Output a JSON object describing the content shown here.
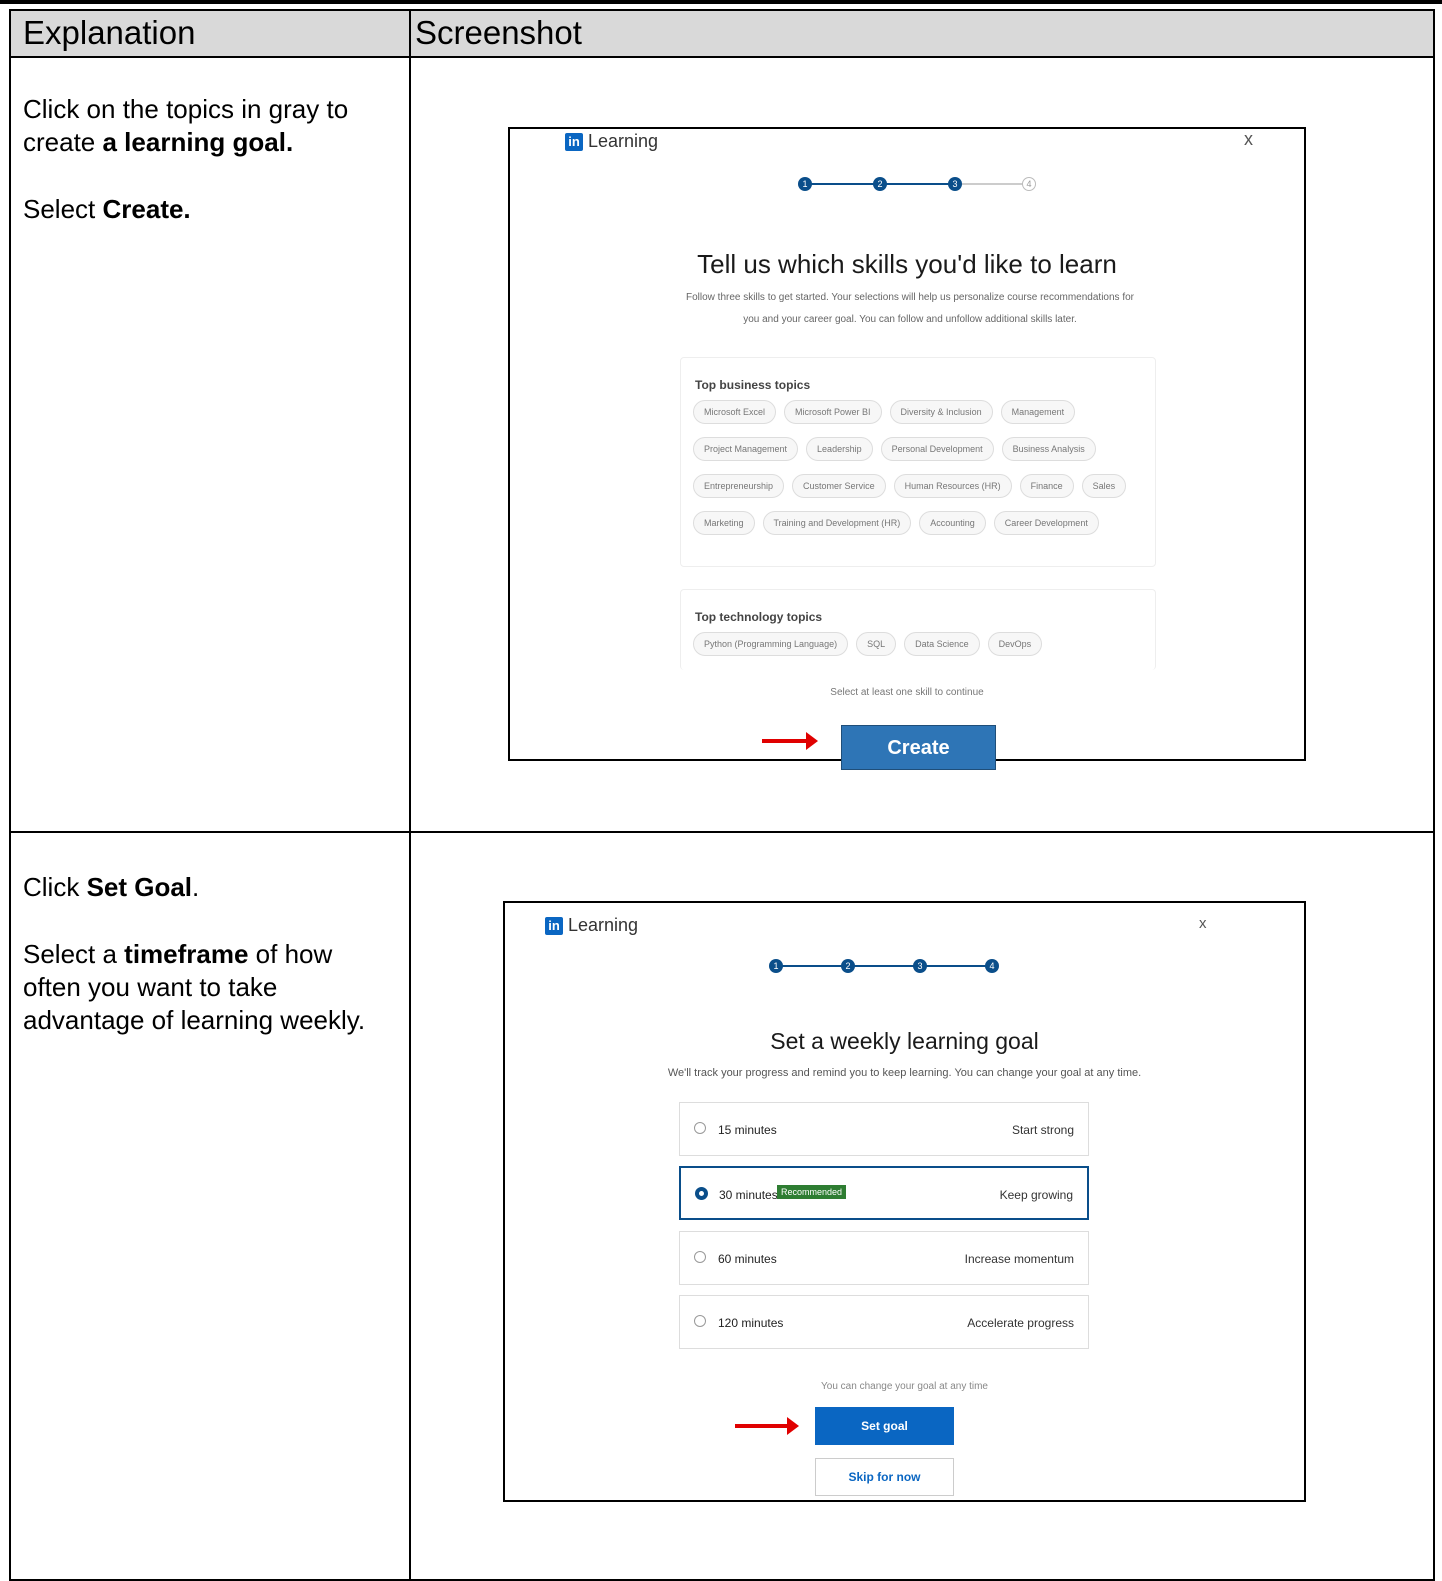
{
  "table": {
    "header_left": "Explanation",
    "header_right": "Screenshot"
  },
  "row1": {
    "explanation": {
      "line1_text": "Click on the topics in gray to create ",
      "line1_bold": "a learning goal.",
      "line2_text": "Select ",
      "line2_bold": "Create."
    },
    "screenshot": {
      "brand_icon": "in",
      "brand_label": "Learning",
      "close_label": "x",
      "steps": [
        "1",
        "2",
        "3",
        "4"
      ],
      "title": "Tell us which skills you'd like to learn",
      "subtitle": "Follow three skills to get started. Your selections will help us personalize course recommendations for you and your career goal. You can follow and unfollow additional skills later.",
      "business_heading": "Top business topics",
      "business_topics": [
        "Microsoft Excel",
        "Microsoft Power BI",
        "Diversity & Inclusion",
        "Management",
        "Project Management",
        "Leadership",
        "Personal Development",
        "Business Analysis",
        "Entrepreneurship",
        "Customer Service",
        "Human Resources (HR)",
        "Finance",
        "Sales",
        "Marketing",
        "Training and Development (HR)",
        "Accounting",
        "Career Development"
      ],
      "technology_heading": "Top technology topics",
      "technology_topics": [
        "Python (Programming Language)",
        "SQL",
        "Data Science",
        "DevOps"
      ],
      "hint": "Select at least one skill to continue",
      "create_button": "Create"
    }
  },
  "row2": {
    "explanation": {
      "line1_text": "Click ",
      "line1_bold": "Set Goal",
      "line1_end": ".",
      "line2_text": "Select a ",
      "line2_bold": "timeframe",
      "line2_end": " of how often you want to take advantage of learning weekly."
    },
    "screenshot": {
      "brand_icon": "in",
      "brand_label": "Learning",
      "close_label": "x",
      "steps": [
        "1",
        "2",
        "3",
        "4"
      ],
      "title": "Set a weekly learning goal",
      "subtitle": "We'll track your progress and remind you to keep learning. You can change your goal at any time.",
      "options": [
        {
          "label": "15 minutes",
          "desc": "Start strong",
          "badge": "",
          "selected": false
        },
        {
          "label": "30 minutes",
          "desc": "Keep growing",
          "badge": "Recommended",
          "selected": true
        },
        {
          "label": "60 minutes",
          "desc": "Increase momentum",
          "badge": "",
          "selected": false
        },
        {
          "label": "120 minutes",
          "desc": "Accelerate progress",
          "badge": "",
          "selected": false
        }
      ],
      "hint": "You can change your goal at any time",
      "set_goal_button": "Set goal",
      "skip_button": "Skip for now"
    }
  },
  "colors": {
    "header_bg": "#d9d9d9",
    "create_blue": "#2e75b6",
    "linkedin_blue": "#0a66c2",
    "stepper_navy": "#0a4e8a",
    "arrow_red": "#e00000",
    "badge_green": "#2e7d32"
  }
}
